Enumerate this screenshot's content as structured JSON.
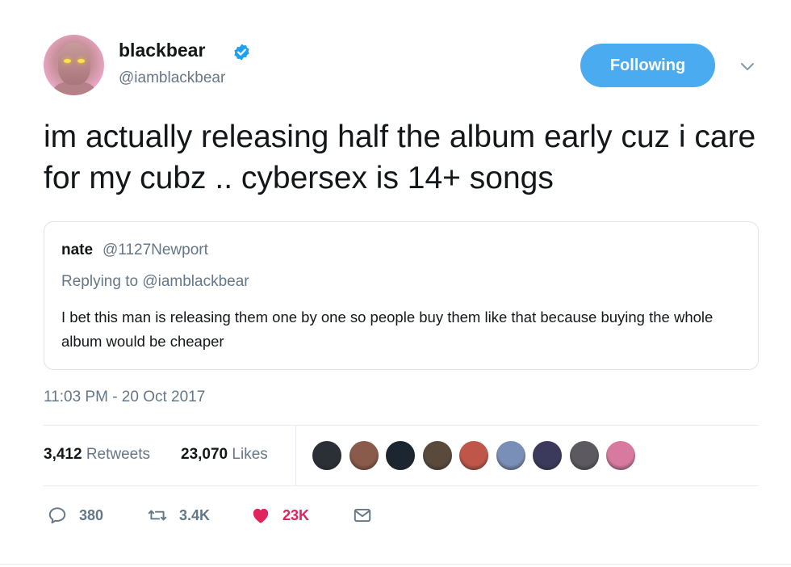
{
  "author": {
    "name": "blackbear",
    "handle": "@iamblackbear",
    "verified": true,
    "avatar_icon": "avatar-glowing-eyes"
  },
  "follow_button": {
    "label": "Following",
    "color": "#4aabf0"
  },
  "tweet": {
    "text": "im actually releasing half the album early cuz i care for my cubz .. cybersex is 14+ songs",
    "timestamp": "11:03 PM - 20 Oct 2017"
  },
  "quoted_tweet": {
    "name": "nate",
    "handle": "@1127Newport",
    "replying_to": "Replying to @iamblackbear",
    "text": "I bet this man is releasing them one by one so people buy them like that because buying the whole album would be cheaper"
  },
  "stats": {
    "retweets_count": "3,412",
    "retweets_label": "Retweets",
    "likes_count": "23,070",
    "likes_label": "Likes"
  },
  "likers": [
    {
      "name": "liker-1",
      "color": "#2b2f36"
    },
    {
      "name": "liker-2",
      "color": "#8a5a4a"
    },
    {
      "name": "liker-3",
      "color": "#1c2630"
    },
    {
      "name": "liker-4",
      "color": "#5a4a3c"
    },
    {
      "name": "liker-5",
      "color": "#c0564a"
    },
    {
      "name": "liker-6",
      "color": "#7a8fb8"
    },
    {
      "name": "liker-7",
      "color": "#3c3a5c"
    },
    {
      "name": "liker-8",
      "color": "#5c5a60"
    },
    {
      "name": "liker-9",
      "color": "#d87aa0"
    }
  ],
  "actions": {
    "reply_count": "380",
    "retweet_count": "3.4K",
    "like_count": "23K",
    "like_color": "#e0245e"
  }
}
